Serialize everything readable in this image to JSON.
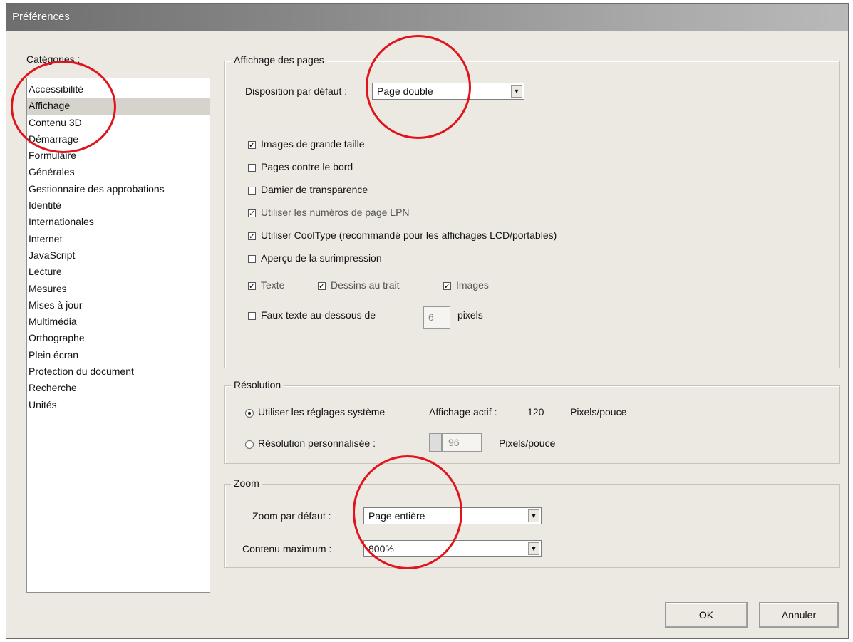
{
  "window": {
    "title": "Préférences"
  },
  "categories": {
    "label": "Catégories :",
    "items": [
      "Accessibilité",
      "Affichage",
      "Contenu 3D",
      "Démarrage",
      "Formulaire",
      "Générales",
      "Gestionnaire des approbations",
      "Identité",
      "Internationales",
      "Internet",
      "JavaScript",
      "Lecture",
      "Mesures",
      "Mises à jour",
      "Multimédia",
      "Orthographe",
      "Plein écran",
      "Protection du document",
      "Recherche",
      "Unités"
    ],
    "selected": "Affichage"
  },
  "page_display": {
    "title": "Affichage des pages",
    "layout_label": "Disposition par défaut :",
    "layout_value": "Page double",
    "options": {
      "large_images": "Images de grande taille",
      "pages_edge": "Pages contre le bord",
      "transparency_grid": "Damier de transparence",
      "lpn": "Utiliser les numéros de page LPN",
      "cooltype": "Utiliser CoolType (recommandé pour les affichages LCD/portables)",
      "overprint": "Aperçu de la surimpression",
      "text": "Texte",
      "lineart": "Dessins au trait",
      "images": "Images",
      "greek_text": "Faux texte au-dessous de",
      "greek_value": "6",
      "pixels": "pixels"
    },
    "checked": {
      "large_images": true,
      "pages_edge": false,
      "transparency_grid": false,
      "lpn": true,
      "cooltype": true,
      "overprint": false,
      "text": true,
      "lineart": true,
      "images": true,
      "greek_text": false
    }
  },
  "resolution": {
    "title": "Résolution",
    "system_label": "Utiliser les réglages système",
    "active_label": "Affichage actif :",
    "active_value": "120",
    "unit": "Pixels/pouce",
    "custom_label": "Résolution personnalisée :",
    "custom_value": "96",
    "custom_unit": "Pixels/pouce"
  },
  "zoom": {
    "title": "Zoom",
    "default_label": "Zoom par défaut :",
    "default_value": "Page entière",
    "max_label": "Contenu maximum :",
    "max_value": "800%"
  },
  "buttons": {
    "ok": "OK",
    "cancel": "Annuler"
  },
  "colors": {
    "annotation": "#e0141c",
    "dialog_bg": "#ece9e2"
  }
}
